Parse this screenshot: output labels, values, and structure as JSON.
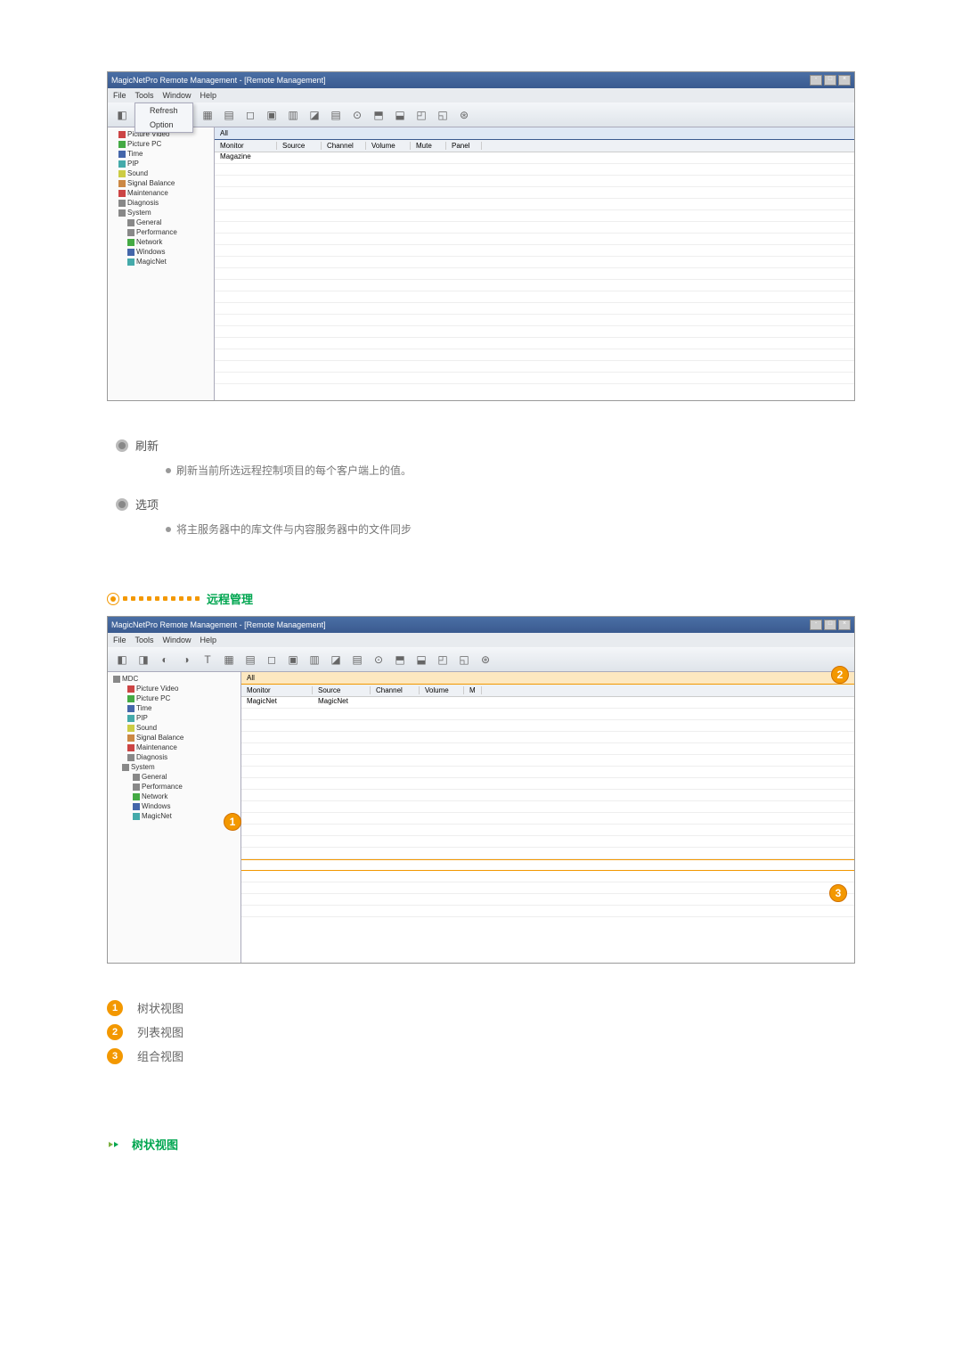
{
  "screenshot1": {
    "title": "MagicNetPro Remote Management - [Remote Management]",
    "menu": {
      "file": "File",
      "tools": "Tools",
      "window": "Window",
      "help": "Help"
    },
    "dropdown": {
      "refresh": "Refresh",
      "option": "Option"
    },
    "filter": "All",
    "columns": [
      "Monitor",
      "Source",
      "Channel",
      "Volume",
      "Mute",
      "Panel"
    ],
    "row1_monitor": "Magazine",
    "tree": {
      "items": [
        {
          "label": "Picture Video",
          "cls": "ti-red"
        },
        {
          "label": "Picture PC",
          "cls": "ti-green"
        },
        {
          "label": "Time",
          "cls": "ti-blue"
        },
        {
          "label": "PIP",
          "cls": "ti-cyan"
        },
        {
          "label": "Sound",
          "cls": "ti-yellow"
        },
        {
          "label": "Signal Balance",
          "cls": "ti-orange"
        },
        {
          "label": "Maintenance",
          "cls": "ti-red"
        },
        {
          "label": "Diagnosis",
          "cls": "ti-gray"
        },
        {
          "label": "System",
          "cls": "ti-gray"
        },
        {
          "label": "General",
          "cls": "ti-gray"
        },
        {
          "label": "Performance",
          "cls": "ti-gray"
        },
        {
          "label": "Network",
          "cls": "ti-green"
        },
        {
          "label": "Windows",
          "cls": "ti-blue"
        },
        {
          "label": "MagicNet",
          "cls": "ti-cyan"
        }
      ]
    }
  },
  "content1": {
    "refresh_heading": "刷新",
    "refresh_desc": "刷新当前所选远程控制项目的每个客户端上的值。",
    "option_heading": "选项",
    "option_desc": "将主服务器中的库文件与内容服务器中的文件同步"
  },
  "section_title": "远程管理",
  "screenshot2": {
    "title": "MagicNetPro Remote Management - [Remote Management]",
    "menu": {
      "file": "File",
      "tools": "Tools",
      "window": "Window",
      "help": "Help"
    },
    "filter": "All",
    "columns": [
      "Monitor",
      "Source",
      "Channel",
      "Volume",
      "M"
    ],
    "row1_monitor": "MagicNet",
    "row1_source": "MagicNet",
    "tree": {
      "root": "MDC",
      "items": [
        {
          "label": "Picture Video",
          "cls": "ti-red"
        },
        {
          "label": "Picture PC",
          "cls": "ti-green"
        },
        {
          "label": "Time",
          "cls": "ti-blue"
        },
        {
          "label": "PIP",
          "cls": "ti-cyan"
        },
        {
          "label": "Sound",
          "cls": "ti-yellow"
        },
        {
          "label": "Signal Balance",
          "cls": "ti-orange"
        },
        {
          "label": "Maintenance",
          "cls": "ti-red"
        },
        {
          "label": "Diagnosis",
          "cls": "ti-gray"
        },
        {
          "label": "System",
          "cls": "ti-gray"
        },
        {
          "label": "General",
          "cls": "ti-gray"
        },
        {
          "label": "Performance",
          "cls": "ti-gray"
        },
        {
          "label": "Network",
          "cls": "ti-green"
        },
        {
          "label": "Windows",
          "cls": "ti-blue"
        },
        {
          "label": "MagicNet",
          "cls": "ti-cyan"
        }
      ]
    }
  },
  "legend": {
    "item1": "树状视图",
    "item2": "列表视图",
    "item3": "组合视图"
  },
  "subsection_title": "树状视图",
  "callout_nums": {
    "n1": "1",
    "n2": "2",
    "n3": "3"
  }
}
